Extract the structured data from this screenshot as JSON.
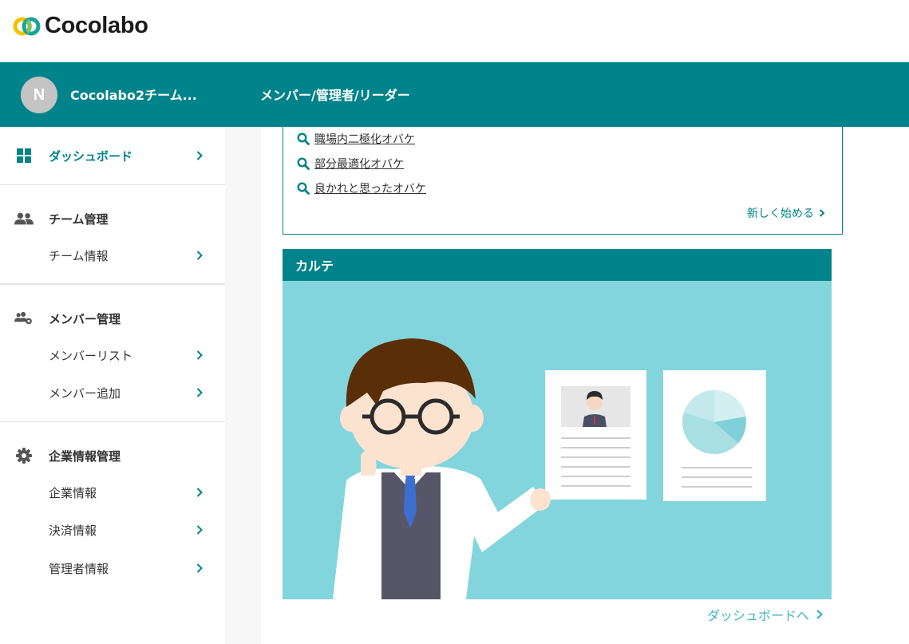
{
  "app": {
    "logo_text": "Cocolabo"
  },
  "team": {
    "avatar_initial": "N",
    "name": "Cocolabo2チーム...",
    "role": "メンバー/管理者/リーダー"
  },
  "sidebar": {
    "dashboard": "ダッシュボード",
    "team_section": "チーム管理",
    "team_info": "チーム情報",
    "member_section": "メンバー管理",
    "member_list": "メンバーリスト",
    "member_add": "メンバー追加",
    "company_section": "企業情報管理",
    "company_info": "企業情報",
    "payment_info": "決済情報",
    "admin_info": "管理者情報"
  },
  "obake": {
    "links": [
      "職場内二極化オバケ",
      "部分最適化オバケ",
      "良かれと思ったオバケ"
    ],
    "start_label": "新しく始める"
  },
  "karte": {
    "title": "カルテ",
    "dashboard_link": "ダッシュボードへ"
  },
  "colors": {
    "brand": "#00838a",
    "illustration_bg": "#83d5dd",
    "link_light": "#3fb5c2"
  }
}
